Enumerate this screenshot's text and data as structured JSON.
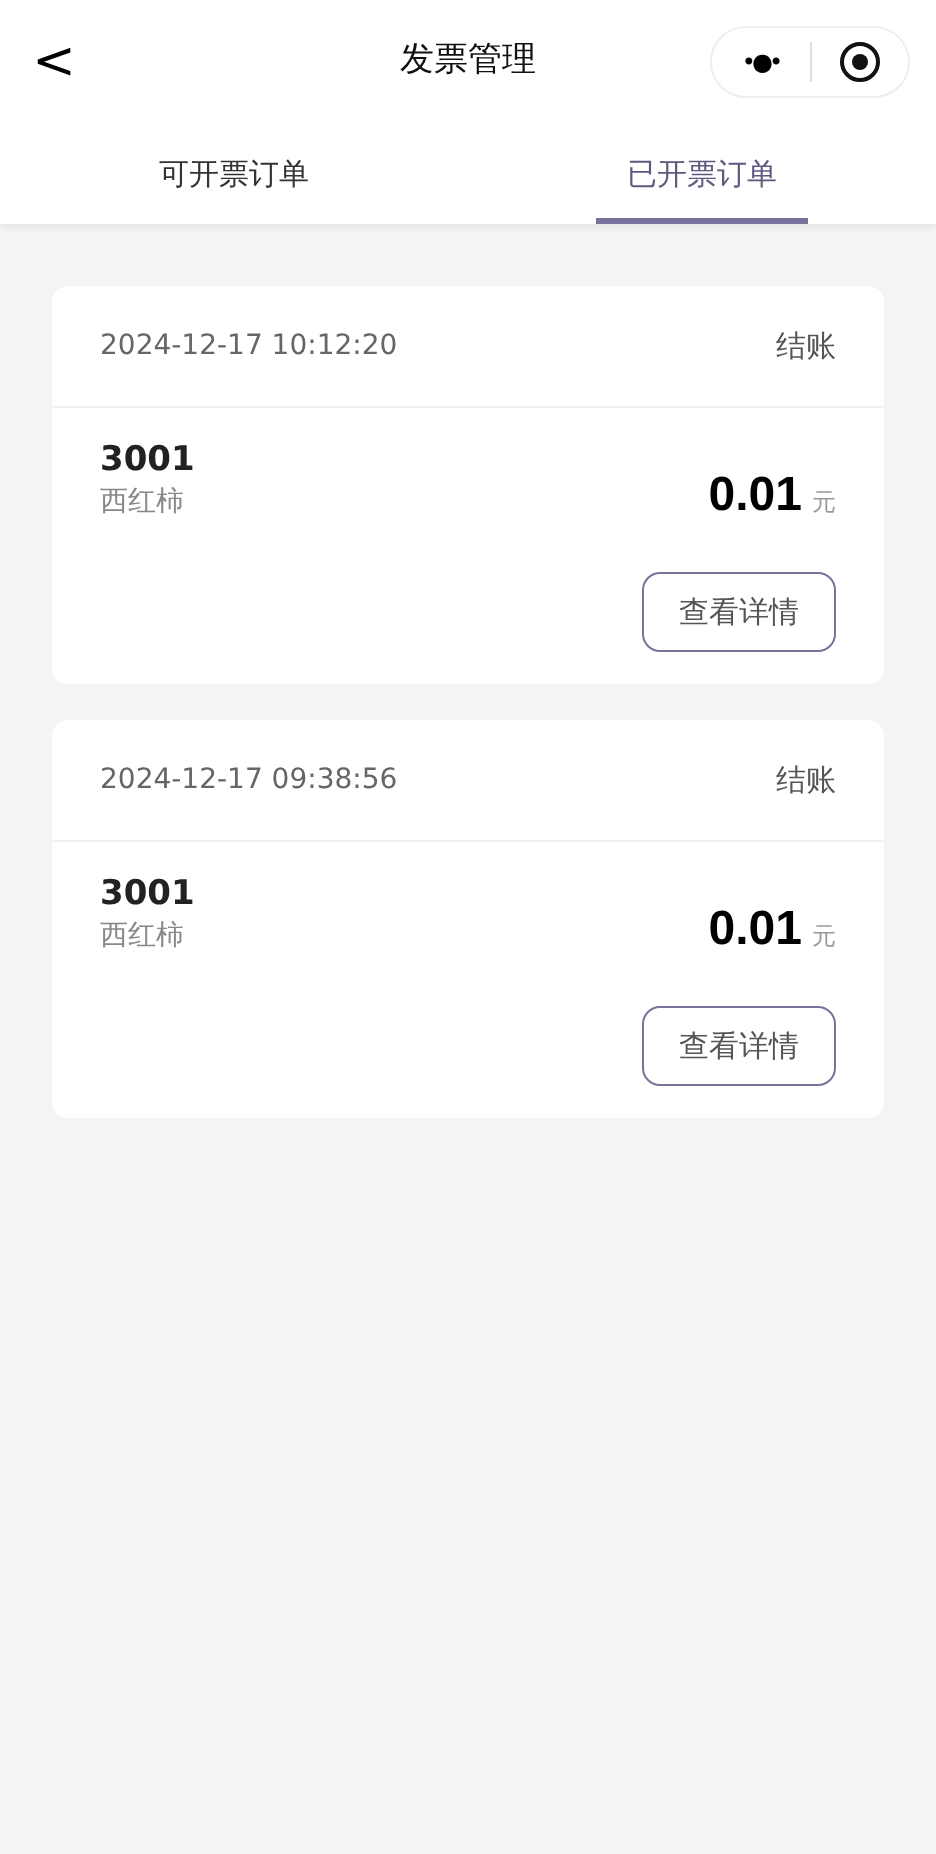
{
  "nav": {
    "back": "<",
    "title": "发票管理",
    "more": "•●•"
  },
  "tabs": [
    {
      "label": "可开票订单",
      "selected": false
    },
    {
      "label": "已开票订单",
      "selected": true
    }
  ],
  "orders": [
    {
      "time": "2024-12-17 10:12:20",
      "status": "结账",
      "number": "3001",
      "item": "西红柿",
      "amount": "0.01",
      "unit": "元",
      "action": "查看详情"
    },
    {
      "time": "2024-12-17 09:38:56",
      "status": "结账",
      "number": "3001",
      "item": "西红柿",
      "amount": "0.01",
      "unit": "元",
      "action": "查看详情"
    }
  ]
}
